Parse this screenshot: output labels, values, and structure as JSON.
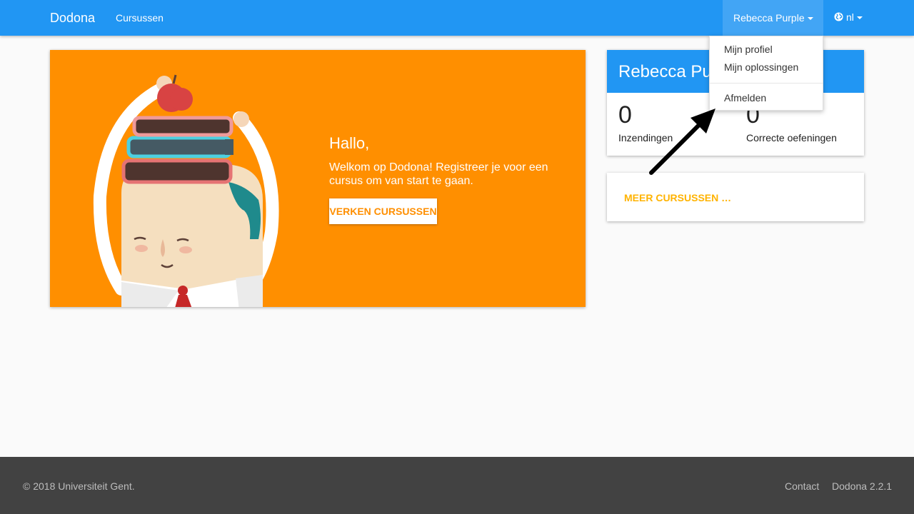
{
  "navbar": {
    "brand": "Dodona",
    "courses_link": "Cursussen",
    "user_name": "Rebecca Purple",
    "language": "nl"
  },
  "user_menu": {
    "items": [
      "Mijn profiel",
      "Mijn oplossingen"
    ],
    "logout": "Afmelden"
  },
  "hero": {
    "title": "Hallo,",
    "text": "Welkom op Dodona! Registreer je voor een cursus om van start te gaan.",
    "button": "VERKEN CURSUSSEN"
  },
  "user_card": {
    "name": "Rebecca Purple",
    "submissions_count": "0",
    "submissions_label": "Inzendingen",
    "correct_count": "0",
    "correct_label": "Correcte oefeningen"
  },
  "more_card": {
    "link": "MEER CURSUSSEN …"
  },
  "footer": {
    "copyright": "© 2018 Universiteit Gent.",
    "contact": "Contact",
    "version": "Dodona 2.2.1"
  },
  "colors": {
    "primary": "#2196f3",
    "hero": "#ff8f00",
    "accent": "#ffb300",
    "footer": "#424242"
  },
  "icons": {
    "language": "globe-icon",
    "annotation": "arrow-icon"
  }
}
